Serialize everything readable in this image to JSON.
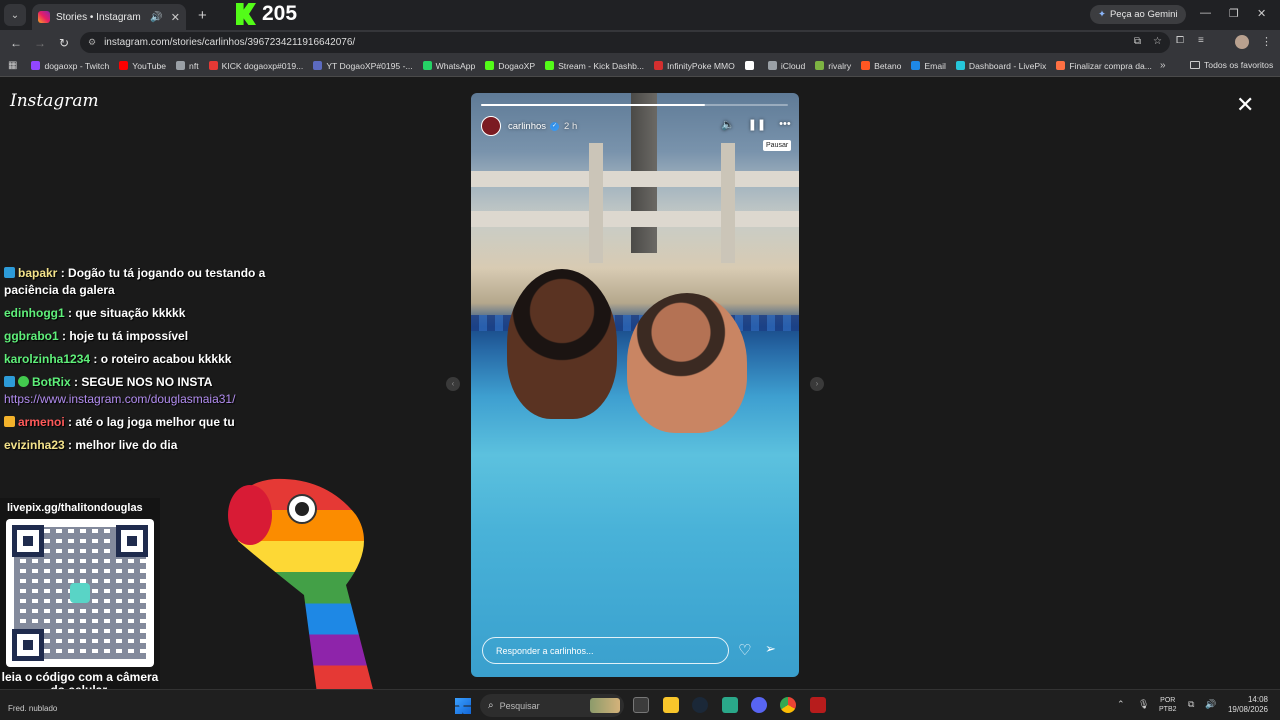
{
  "browser": {
    "tab": {
      "title": "Stories • Instagram"
    },
    "kick_counter": "205",
    "gemini_button": "Peça ao Gemini",
    "url": "instagram.com/stories/carlinhos/3967234211916642076/",
    "bookmarks": [
      {
        "label": "dogaoxp - Twitch",
        "color": "#9146ff"
      },
      {
        "label": "YouTube",
        "color": "#ff0000"
      },
      {
        "label": "nft",
        "color": "#9aa0a6"
      },
      {
        "label": "KICK dogaoxp#019...",
        "color": "#e53935"
      },
      {
        "label": "YT DogaoXP#0195 -...",
        "color": "#5c6bc0"
      },
      {
        "label": "WhatsApp",
        "color": "#25d366"
      },
      {
        "label": "DogaoXP",
        "color": "#53fc18"
      },
      {
        "label": "Stream - Kick Dashb...",
        "color": "#53fc18"
      },
      {
        "label": "InfinityPoke MMO",
        "color": "#d32f2f"
      },
      {
        "label": "",
        "color": "#ffffff"
      },
      {
        "label": "iCloud",
        "color": "#9aa0a6"
      },
      {
        "label": "rivalry",
        "color": "#7cb342"
      },
      {
        "label": "Betano",
        "color": "#ff5722"
      },
      {
        "label": "Email",
        "color": "#1e88e5"
      },
      {
        "label": "Dashboard - LivePix",
        "color": "#26c6da"
      },
      {
        "label": "Finalizar compra da...",
        "color": "#ff7043"
      }
    ],
    "all_bookmarks": "Todos os favoritos"
  },
  "instagram": {
    "logo": "Instagram",
    "story": {
      "username": "carlinhos",
      "time": "2 h",
      "tooltip": "Pausar",
      "reply_placeholder": "Responder a carlinhos...",
      "progress": 0.73
    }
  },
  "chat": {
    "messages": [
      {
        "user": "bapakr",
        "color": "#f3e28a",
        "badge": "blue",
        "text": "Dogão tu tá jogando ou testando a paciência da galera"
      },
      {
        "user": "edinhogg1",
        "color": "#5ff07a",
        "badge": "",
        "text": "que situação kkkkk"
      },
      {
        "user": "ggbrabo1",
        "color": "#5ff07a",
        "badge": "",
        "text": "hoje tu tá impossível"
      },
      {
        "user": "karolzinha1234",
        "color": "#5ff07a",
        "badge": "",
        "text": "o roteiro acabou kkkkk"
      },
      {
        "user": "BotRix",
        "color": "#5ff07a",
        "badge": "blue-green",
        "text": "SEGUE NOS NO INSTA",
        "link": "https://www.instagram.com/douglasmaia31/"
      },
      {
        "user": "armenoi",
        "color": "#ff5a5a",
        "badge": "yellow",
        "text": "até o lag joga melhor que tu"
      },
      {
        "user": "evizinha23",
        "color": "#f3e28a",
        "badge": "",
        "text": "melhor live do dia"
      }
    ]
  },
  "livepix": {
    "title": "livepix.gg/thalitondouglas",
    "caption": "leia o código com a câmera do celular."
  },
  "taskbar": {
    "weather": "Fred. nublado",
    "search_placeholder": "Pesquisar",
    "lang": "POR",
    "layout": "PTB2",
    "time": "14:08",
    "date": "19/08/2026"
  }
}
